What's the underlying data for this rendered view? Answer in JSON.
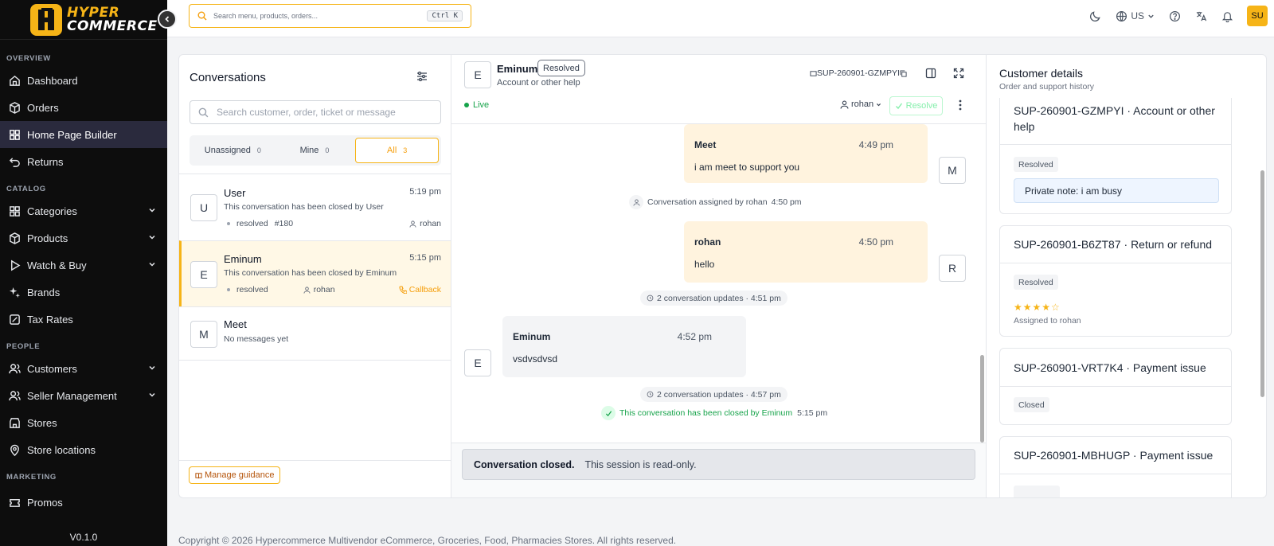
{
  "brand": {
    "line1": "HYPER",
    "line2": "COMMERCE",
    "accent": "#f6b417"
  },
  "sidebar": {
    "sections": [
      {
        "label": "OVERVIEW",
        "items": [
          {
            "label": "Dashboard",
            "icon": "home-icon"
          },
          {
            "label": "Orders",
            "icon": "box-icon"
          },
          {
            "label": "Home Page Builder",
            "icon": "grid-icon",
            "active": true
          },
          {
            "label": "Returns",
            "icon": "undo-icon"
          }
        ]
      },
      {
        "label": "CATALOG",
        "items": [
          {
            "label": "Categories",
            "icon": "grid-icon",
            "expandable": true
          },
          {
            "label": "Products",
            "icon": "box-icon",
            "expandable": true
          },
          {
            "label": "Watch & Buy",
            "icon": "play-icon",
            "expandable": true
          },
          {
            "label": "Brands",
            "icon": "sparkle-icon"
          },
          {
            "label": "Tax Rates",
            "icon": "percent-icon"
          }
        ]
      },
      {
        "label": "PEOPLE",
        "items": [
          {
            "label": "Customers",
            "icon": "users-icon",
            "expandable": true
          },
          {
            "label": "Seller Management",
            "icon": "users-icon",
            "expandable": true
          },
          {
            "label": "Stores",
            "icon": "store-icon"
          },
          {
            "label": "Store locations",
            "icon": "pin-icon"
          }
        ]
      },
      {
        "label": "MARKETING",
        "items": [
          {
            "label": "Promos",
            "icon": "ticket-icon"
          }
        ]
      }
    ],
    "version": "V0.1.0"
  },
  "topbar": {
    "search_placeholder": "Search menu, products, orders...",
    "shortcut": "Ctrl K",
    "locale": "US",
    "user_initials": "SU"
  },
  "conversations": {
    "title": "Conversations",
    "search_placeholder": "Search customer, order, ticket or message",
    "tabs": [
      {
        "label": "Unassigned",
        "count": "0"
      },
      {
        "label": "Mine",
        "count": "0"
      },
      {
        "label": "All",
        "count": "3",
        "active": true
      }
    ],
    "items": [
      {
        "initial": "U",
        "name": "User",
        "time": "5:19 pm",
        "message": "This conversation has been closed by User",
        "status": "resolved",
        "ref": "#180",
        "agent": "rohan"
      },
      {
        "initial": "E",
        "name": "Eminum",
        "time": "5:15 pm",
        "message": "This conversation has been closed by Eminum",
        "status": "resolved",
        "agent": "rohan",
        "callback": "Callback",
        "selected": true
      },
      {
        "initial": "M",
        "name": "Meet",
        "message": "No messages yet"
      }
    ],
    "guidance_label": "Manage guidance"
  },
  "chat": {
    "initial": "E",
    "name": "Eminum",
    "badge": "Resolved",
    "subtitle": "Account or other help",
    "ticket": "SUP-260901-GZMPYI",
    "live": "Live",
    "assignee": "rohan",
    "resolve_label": "Resolve",
    "messages": [
      {
        "author": "Meet",
        "time": "4:49 pm",
        "text": "i am meet to support you",
        "initial": "M"
      },
      {
        "author": "rohan",
        "time": "4:50 pm",
        "text": "hello",
        "initial": "R"
      },
      {
        "author": "Eminum",
        "time": "4:52 pm",
        "text": "vsdvsdvsd",
        "initial": "E"
      }
    ],
    "system_assigned": "Conversation assigned by rohan",
    "system_assigned_time": "4:50 pm",
    "updates_1": "2 conversation updates · 4:51 pm",
    "updates_2": "2 conversation updates · 4:57 pm",
    "closed_text": "This conversation has been closed by Eminum",
    "closed_time": "5:15 pm",
    "footer_bold": "Conversation closed.",
    "footer_text": "This session is read-only."
  },
  "details": {
    "title": "Customer details",
    "subtitle": "Order and support history",
    "tickets": [
      {
        "title": "SUP-260901-GZMPYI · Account or other help",
        "status": "Resolved",
        "note": "Private note: i am busy"
      },
      {
        "title": "SUP-260901-B6ZT87 · Return or refund",
        "status": "Resolved",
        "rating": 4,
        "stars": "★★★★☆",
        "assigned": "Assigned to rohan"
      },
      {
        "title": "SUP-260901-VRT7K4 · Payment issue",
        "status": "Closed"
      },
      {
        "title": "SUP-260901-MBHUGP · Payment issue"
      }
    ]
  },
  "footer": {
    "text": "Copyright © 2026 Hypercommerce Multivendor eCommerce, Groceries, Food, Pharmacies Stores. All rights reserved."
  }
}
